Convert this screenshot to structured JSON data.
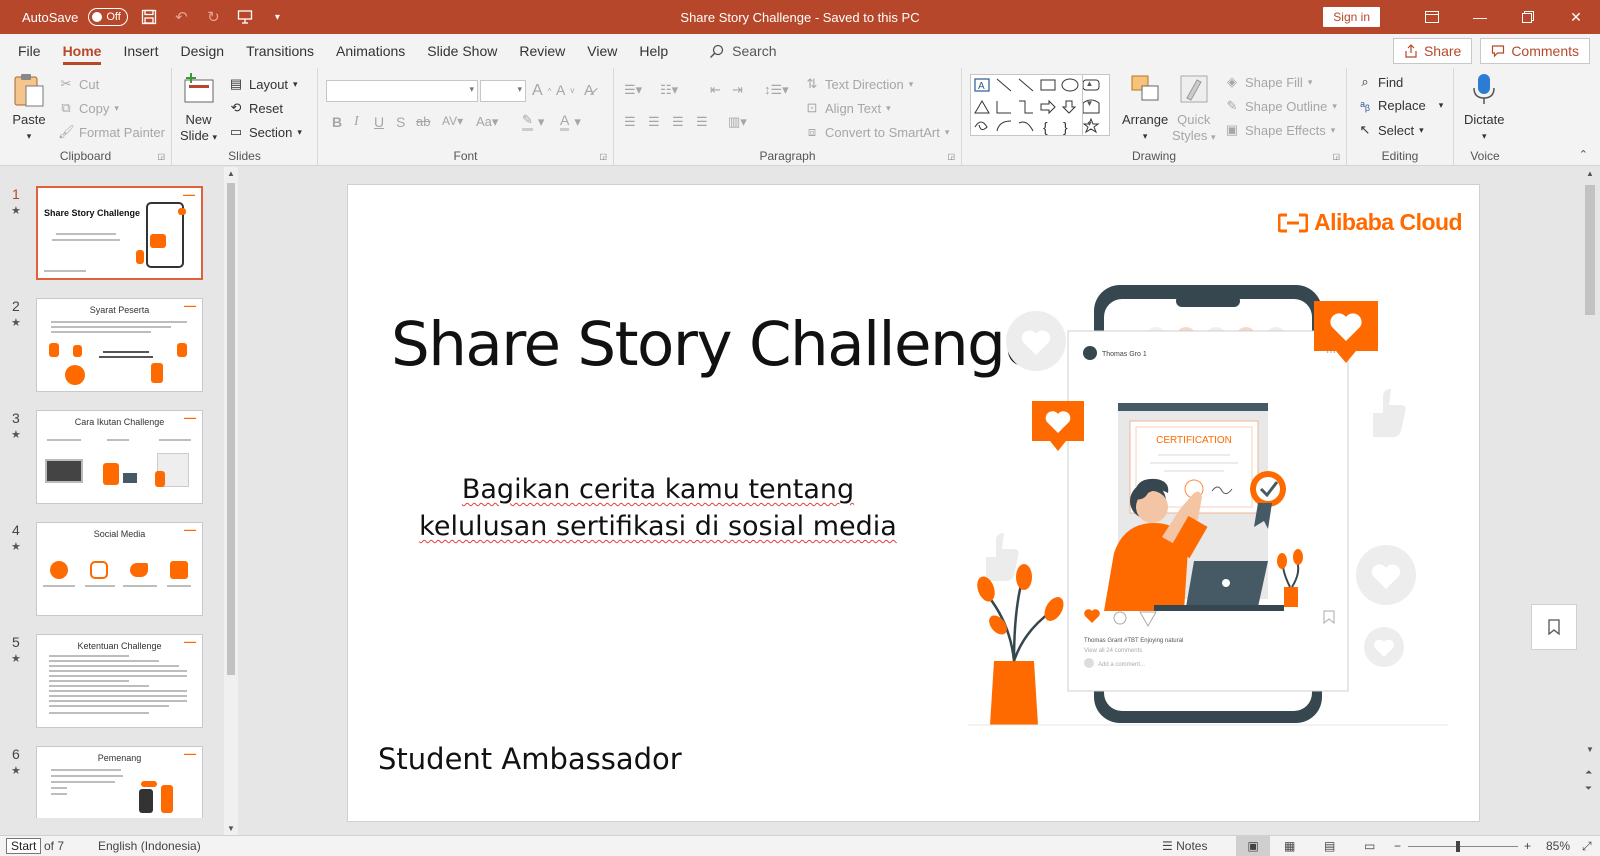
{
  "titlebar": {
    "autosave_label": "AutoSave",
    "autosave_state": "Off",
    "title": "Share Story Challenge  -  Saved to this PC",
    "signin": "Sign in"
  },
  "menu": {
    "tabs": [
      "File",
      "Home",
      "Insert",
      "Design",
      "Transitions",
      "Animations",
      "Slide Show",
      "Review",
      "View",
      "Help"
    ],
    "active": "Home",
    "search": "Search",
    "share": "Share",
    "comments": "Comments"
  },
  "ribbon": {
    "clipboard": {
      "paste": "Paste",
      "cut": "Cut",
      "copy": "Copy",
      "format_painter": "Format Painter",
      "label": "Clipboard"
    },
    "slides": {
      "new_slide_1": "New",
      "new_slide_2": "Slide",
      "layout": "Layout",
      "reset": "Reset",
      "section": "Section",
      "label": "Slides"
    },
    "font": {
      "label": "Font"
    },
    "paragraph": {
      "text_direction": "Text Direction",
      "align_text": "Align Text",
      "convert_smartart": "Convert to SmartArt",
      "label": "Paragraph"
    },
    "drawing": {
      "arrange": "Arrange",
      "quick_1": "Quick",
      "quick_2": "Styles",
      "shape_fill": "Shape Fill",
      "shape_outline": "Shape Outline",
      "shape_effects": "Shape Effects",
      "label": "Drawing"
    },
    "editing": {
      "find": "Find",
      "replace": "Replace",
      "select": "Select",
      "label": "Editing"
    },
    "voice": {
      "dictate": "Dictate",
      "label": "Voice"
    }
  },
  "thumbnails": [
    {
      "num": "1",
      "title": "Share Story Challenge"
    },
    {
      "num": "2",
      "title": "Syarat Peserta"
    },
    {
      "num": "3",
      "title": "Cara Ikutan Challenge"
    },
    {
      "num": "4",
      "title": "Social Media"
    },
    {
      "num": "5",
      "title": "Ketentuan Challenge"
    },
    {
      "num": "6",
      "title": "Pemenang"
    }
  ],
  "slide": {
    "title": "Share Story Challenge",
    "subtitle_1": "Bagikan cerita kamu tentang",
    "subtitle_2": "kelulusan sertifikasi di sosial media",
    "footer": "Student Ambassador",
    "logo": "Alibaba Cloud",
    "cert_text": "CERTIFICATION",
    "post_user": "Thomas Gro  1",
    "post_caption": "Thomas Grant  #TBT  Enjoying natural",
    "post_comments": "View all 24 comments",
    "post_add": "Add a comment..."
  },
  "status": {
    "start": "Start",
    "slide_of": "of 7",
    "language": "English (Indonesia)",
    "notes": "Notes",
    "zoom": "85%"
  },
  "colors": {
    "accent": "#b7472a",
    "brand": "#ff6a00"
  }
}
